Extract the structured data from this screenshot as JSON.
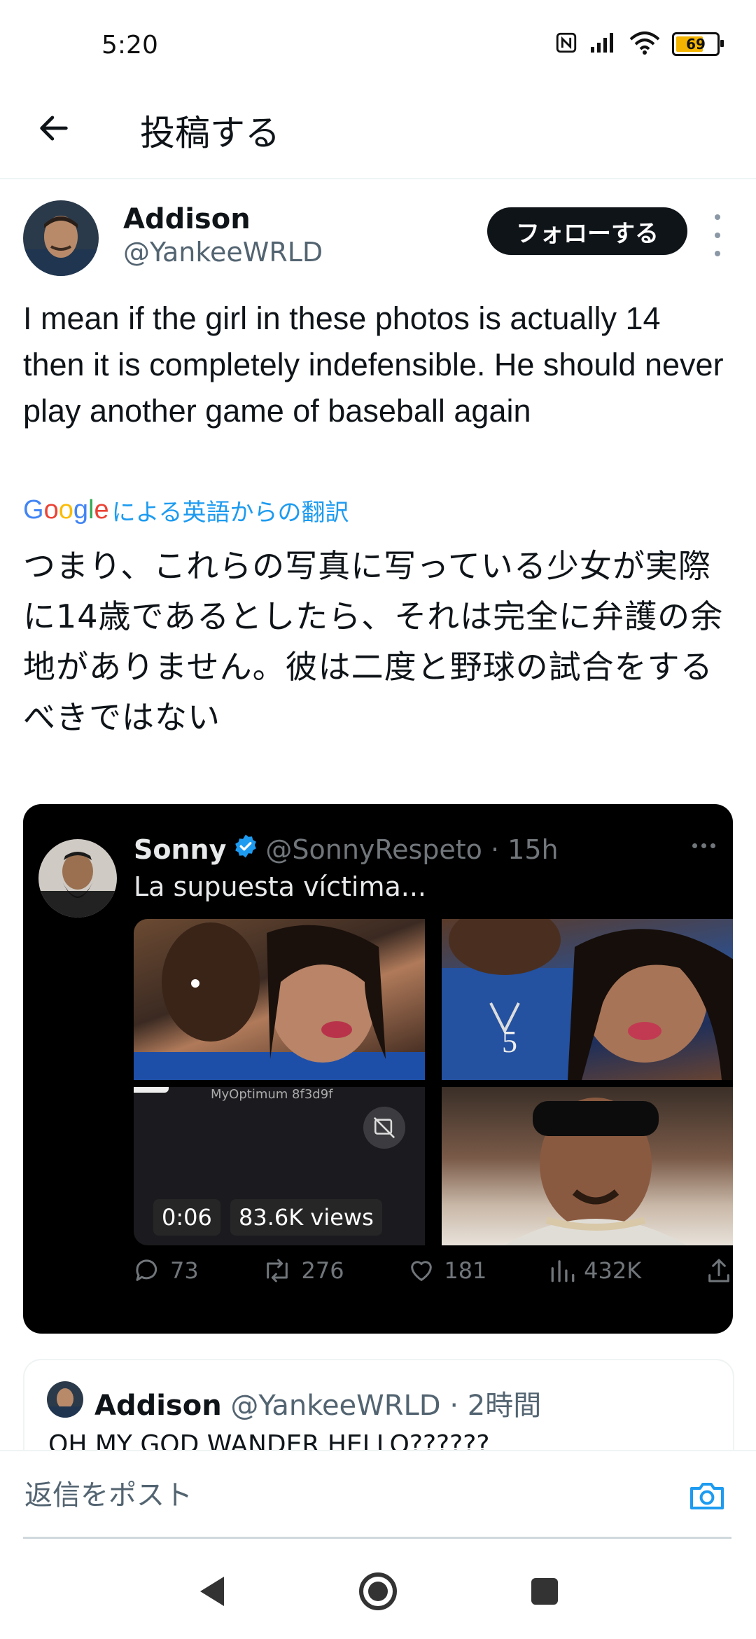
{
  "status": {
    "time": "5:20",
    "battery": "69"
  },
  "header": {
    "title": "投稿する"
  },
  "author": {
    "name": "Addison",
    "handle": "@YankeeWRLD",
    "follow_label": "フォローする"
  },
  "tweet": {
    "text": "I mean if the girl in these photos is actually 14 then it is completely indefensible. He should never play another game of baseball again",
    "translate_brand": "Google",
    "translate_label": "による英語からの翻訳",
    "translated_text": "つまり、これらの写真に写っている少女が実際に14歳であるとしたら、それは完全に弁護の余地がありません。彼は二度と野球の試合をするべきではない"
  },
  "embedded": {
    "name": "Sonny",
    "meta": "@SonnyRespeto · 15h",
    "text": "La supuesta víctima...",
    "video_header": "MyOptimum 8f3d9f",
    "video_time": "0:06",
    "video_views": "83.6K views",
    "replies": "73",
    "retweets": "276",
    "likes": "181",
    "views": "432K"
  },
  "quote": {
    "name": "Addison",
    "meta": "@YankeeWRLD · 2時間",
    "text": "OH MY GOD WANDER HELLO??????"
  },
  "reply": {
    "placeholder": "返信をポスト"
  },
  "colors": {
    "accent": "#1d9bf0",
    "text": "#0f1419",
    "muted": "#536471",
    "card_bg": "#000000"
  },
  "icons": [
    "back-arrow-icon",
    "more-vertical-icon",
    "verified-icon",
    "gif-off-icon",
    "reply-icon",
    "retweet-icon",
    "like-icon",
    "views-icon",
    "share-icon",
    "camera-icon",
    "nav-back-icon",
    "nav-home-icon",
    "nav-recents-icon"
  ]
}
